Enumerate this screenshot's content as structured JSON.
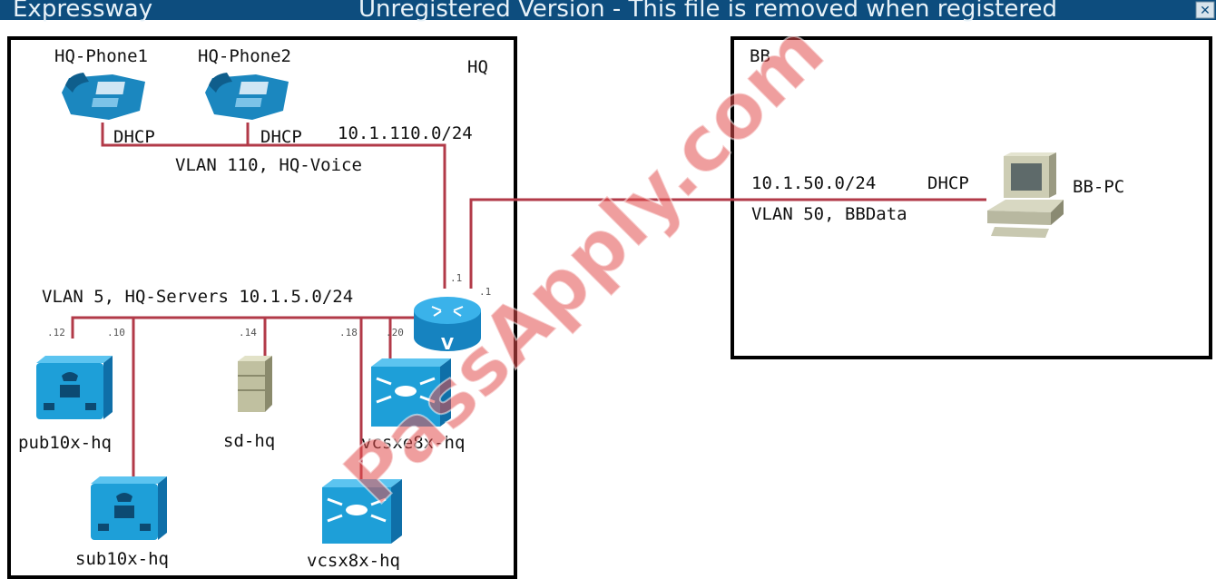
{
  "banner": {
    "left_text": "Expressway",
    "text": "Unregistered Version - This file is removed when registered",
    "close_glyph": "✕",
    "color": "#0d4d7e"
  },
  "hq": {
    "site_label": "HQ",
    "phone1": "HQ-Phone1",
    "phone2": "HQ-Phone2",
    "dhcp1": "DHCP",
    "dhcp2": "DHCP",
    "voice_subnet": "10.1.110.0/24",
    "voice_vlan": "VLAN 110, HQ-Voice",
    "servers_vlan": "VLAN 5, HQ-Servers 10.1.5.0/24",
    "router_ports": [
      ".1",
      ".1"
    ],
    "server_octets": [
      ".12",
      ".10",
      ".14",
      ".18",
      ".20"
    ],
    "servers": {
      "pub": "pub10x-hq",
      "sub": "sub10x-hq",
      "sd": "sd-hq",
      "vcsxe": "vcsxe8x-hq",
      "vcsx": "vcsx8x-hq"
    },
    "router_glyph": "V"
  },
  "bb": {
    "site_label": "BB",
    "subnet": "10.1.50.0/24",
    "dhcp": "DHCP",
    "vlan": "VLAN 50, BBData",
    "pc": "BB-PC"
  },
  "watermark": "PassApply.com",
  "colors": {
    "link": "#b23a48",
    "border": "#000000",
    "device_blue": "#1e9fd8",
    "watermark": "#e24e4e"
  }
}
